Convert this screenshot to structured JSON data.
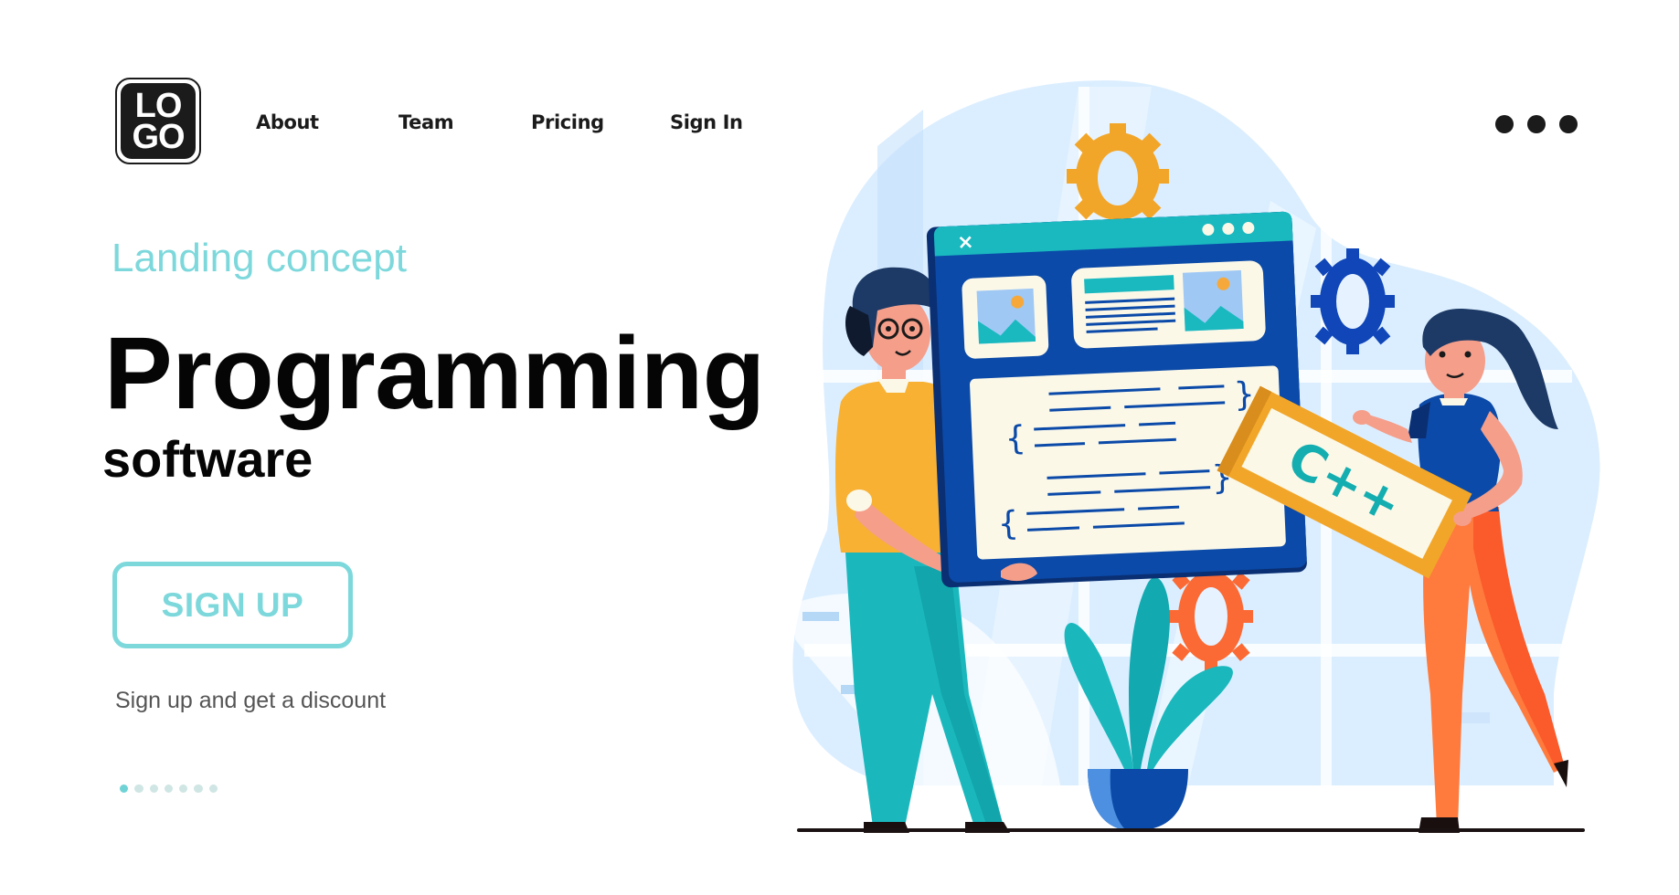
{
  "header": {
    "logo_lines": [
      "LO",
      "GO"
    ],
    "nav": [
      {
        "label": "About"
      },
      {
        "label": "Team"
      },
      {
        "label": "Pricing"
      },
      {
        "label": "Sign In"
      }
    ],
    "more_icon": "more-horizontal-icon"
  },
  "hero": {
    "eyebrow": "Landing concept",
    "title": "Programming",
    "subtitle": "software",
    "cta_label": "SIGN UP",
    "cta_note": "Sign up and get a discount",
    "pager": {
      "total": 7,
      "active_index": 0
    }
  },
  "illustration": {
    "description": "Two developers holding a large browser window with code and a C++ sign",
    "sign_text": "C++",
    "window_close_glyph": "×",
    "icons": [
      "gear-icon",
      "gear-icon",
      "gear-icon",
      "image-placeholder-icon",
      "potted-plant"
    ]
  },
  "colors": {
    "accent": "#7dd8dc",
    "text": "#050505",
    "muted": "#555555",
    "teal": "#19b9bf",
    "navy": "#0b4aa8",
    "mustard": "#f8b133",
    "orange": "#ff7a3d",
    "cream": "#fbf8e8"
  }
}
